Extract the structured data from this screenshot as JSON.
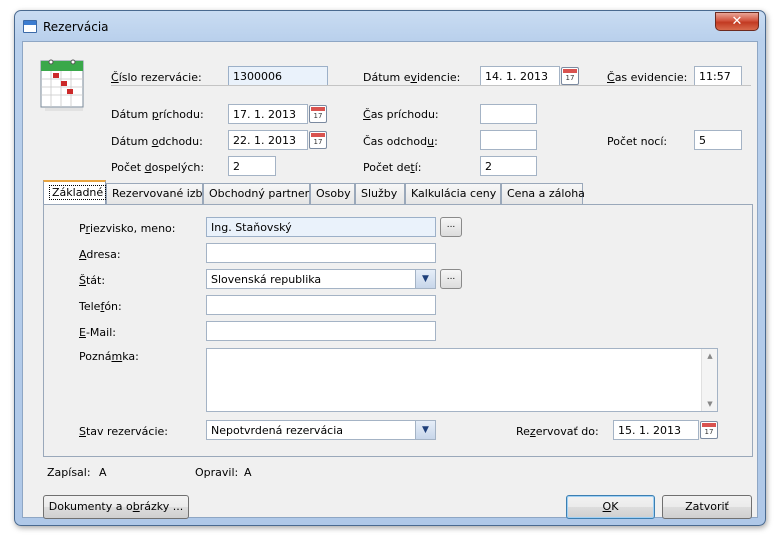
{
  "window": {
    "title": "Rezervácia",
    "close_glyph": "✕"
  },
  "header": {
    "reservation_number": {
      "label_pre": "",
      "label_u": "Č",
      "label_post": "íslo rezervácie:",
      "value": "1300006"
    },
    "record_date": {
      "label_pre": "Dátum e",
      "label_u": "v",
      "label_post": "idencie:",
      "value": "14. 1. 2013"
    },
    "record_time": {
      "label_pre": "",
      "label_u": "Č",
      "label_post": "as evidencie:",
      "value": "11:57"
    },
    "arrival_date": {
      "label_pre": "Dátum ",
      "label_u": "p",
      "label_post": "ríchodu:",
      "value": "17. 1. 2013"
    },
    "arrival_time": {
      "label_pre": "",
      "label_u": "Č",
      "label_post": "as príchodu:",
      "value": ""
    },
    "departure_date": {
      "label_pre": "Dátum ",
      "label_u": "o",
      "label_post": "dchodu:",
      "value": "22. 1. 2013"
    },
    "departure_time": {
      "label_pre": "Čas odchod",
      "label_u": "u",
      "label_post": ":",
      "value": ""
    },
    "nights": {
      "label": "Počet nocí:",
      "value": "5"
    },
    "adults": {
      "label_pre": "Počet ",
      "label_u": "d",
      "label_post": "ospelých:",
      "value": "2"
    },
    "children": {
      "label_pre": "Počet de",
      "label_u": "t",
      "label_post": "í:",
      "value": "2"
    },
    "calendar_day": "17"
  },
  "tabs": [
    {
      "label": "Základné"
    },
    {
      "label": "Rezervované izby"
    },
    {
      "label": "Obchodný partner"
    },
    {
      "label": "Osoby"
    },
    {
      "label": "Služby"
    },
    {
      "label": "Kalkulácia ceny"
    },
    {
      "label": "Cena a záloha"
    }
  ],
  "basic": {
    "name": {
      "label_pre": "P",
      "label_u": "r",
      "label_post": "iezvisko, meno:",
      "value": "Ing. Staňovský"
    },
    "address": {
      "label_pre": "",
      "label_u": "A",
      "label_post": "dresa:",
      "value": ""
    },
    "state": {
      "label_pre": "",
      "label_u": "Š",
      "label_post": "tát:",
      "value": "Slovenská republika"
    },
    "phone": {
      "label_pre": "Tele",
      "label_u": "f",
      "label_post": "ón:",
      "value": ""
    },
    "email": {
      "label_pre": "",
      "label_u": "E",
      "label_post": "-Mail:",
      "value": ""
    },
    "note": {
      "label_pre": "Pozná",
      "label_u": "m",
      "label_post": "ka:",
      "value": ""
    },
    "status": {
      "label_pre": "",
      "label_u": "S",
      "label_post": "tav rezervácie:",
      "value": "Nepotvrdená rezervácia"
    },
    "reserve_until": {
      "label_pre": "Re",
      "label_u": "z",
      "label_post": "ervovať do:",
      "value": "15. 1. 2013"
    },
    "dots_glyph": "...",
    "combo_glyph": "▼",
    "scroll_up_glyph": "▲",
    "scroll_down_glyph": "▼"
  },
  "footer": {
    "written_label": "Zapísal:",
    "written_value": "A",
    "modified_label": "Opravil:",
    "modified_value": "A"
  },
  "buttons": {
    "documents": {
      "pre": "Dokumenty a o",
      "u": "b",
      "post": "rázky ..."
    },
    "ok": {
      "pre": "",
      "u": "O",
      "post": "K"
    },
    "close": {
      "pre": "Zatvoriť",
      "u": "",
      "post": ""
    }
  },
  "colors": {
    "accent": "#e8a440",
    "title_bg": "#b9d0ec",
    "close_red": "#c23a22"
  }
}
